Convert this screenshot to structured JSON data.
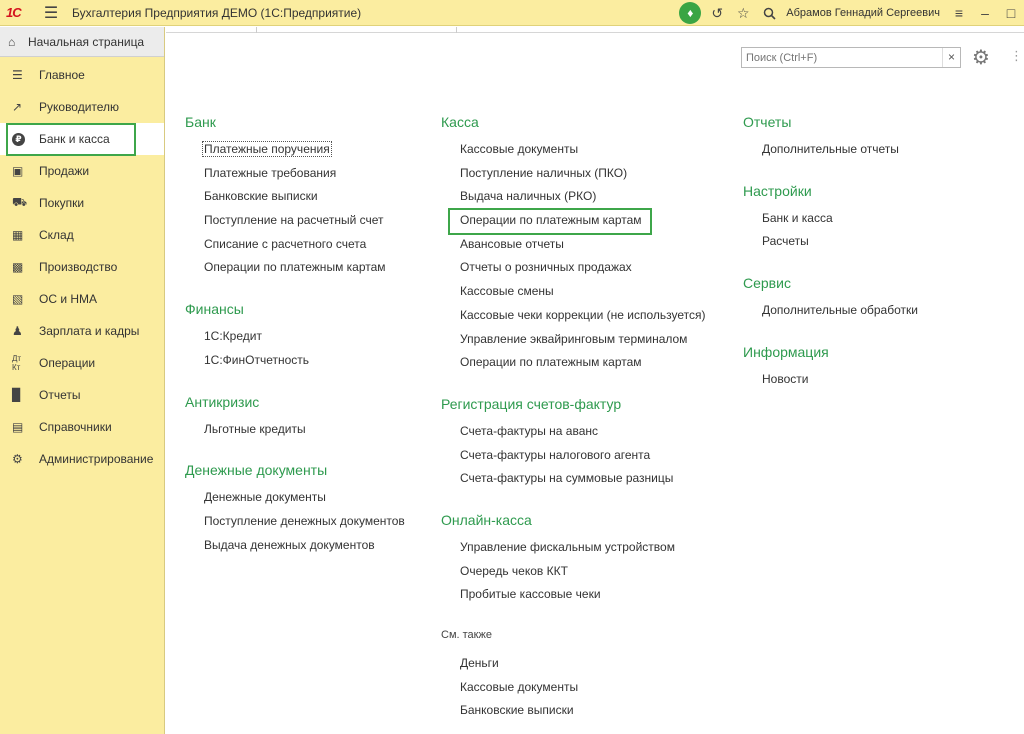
{
  "title_bar": {
    "logo": "1С",
    "title": "Бухгалтерия Предприятия ДЕМО  (1С:Предприятие)",
    "user": "Абрамов Геннадий Сергеевич"
  },
  "sidebar": {
    "home": "Начальная страница",
    "items": [
      {
        "label": "Главное",
        "icon": "menu-lines-icon"
      },
      {
        "label": "Руководителю",
        "icon": "trend-chart-icon"
      },
      {
        "label": "Банк и касса",
        "icon": "ruble-circle-icon"
      },
      {
        "label": "Продажи",
        "icon": "shopping-bag-icon"
      },
      {
        "label": "Покупки",
        "icon": "shopping-cart-icon"
      },
      {
        "label": "Склад",
        "icon": "grid-icon"
      },
      {
        "label": "Производство",
        "icon": "factory-icon"
      },
      {
        "label": "ОС и НМА",
        "icon": "truck-icon"
      },
      {
        "label": "Зарплата и кадры",
        "icon": "person-icon"
      },
      {
        "label": "Операции",
        "icon": "debit-credit-icon"
      },
      {
        "label": "Отчеты",
        "icon": "bar-chart-icon"
      },
      {
        "label": "Справочники",
        "icon": "books-icon"
      },
      {
        "label": "Администрирование",
        "icon": "gear-icon"
      }
    ],
    "active_index": 2
  },
  "search": {
    "placeholder": "Поиск (Ctrl+F)",
    "clear": "×"
  },
  "col1": {
    "bank": {
      "title": "Банк",
      "links": [
        "Платежные поручения",
        "Платежные требования",
        "Банковские выписки",
        "Поступление на расчетный счет",
        "Списание с расчетного счета",
        "Операции по платежным картам"
      ]
    },
    "finance": {
      "title": "Финансы",
      "links": [
        "1С:Кредит",
        "1С:ФинОтчетность"
      ]
    },
    "anticrisis": {
      "title": "Антикризис",
      "links": [
        "Льготные кредиты"
      ]
    },
    "money_docs": {
      "title": "Денежные документы",
      "links": [
        "Денежные документы",
        "Поступление денежных документов",
        "Выдача денежных документов"
      ]
    }
  },
  "col2": {
    "kassa": {
      "title": "Касса",
      "links": [
        "Кассовые документы",
        "Поступление наличных (ПКО)",
        "Выдача наличных (РКО)",
        "Операции по платежным картам",
        "Авансовые отчеты",
        "Отчеты о розничных продажах",
        "Кассовые смены",
        "Кассовые чеки коррекции (не используется)",
        "Управление эквайринговым терминалом",
        "Операции по платежным картам"
      ]
    },
    "invoices": {
      "title": "Регистрация счетов-фактур",
      "links": [
        "Счета-фактуры на аванс",
        "Счета-фактуры налогового агента",
        "Счета-фактуры на суммовые разницы"
      ]
    },
    "online": {
      "title": "Онлайн-касса",
      "links": [
        "Управление фискальным устройством",
        "Очередь чеков ККТ",
        "Пробитые кассовые чеки"
      ]
    },
    "see_also": {
      "title": "См. также",
      "links": [
        "Деньги",
        "Кассовые документы",
        "Банковские выписки"
      ]
    }
  },
  "col3": {
    "reports": {
      "title": "Отчеты",
      "links": [
        "Дополнительные отчеты"
      ]
    },
    "settings": {
      "title": "Настройки",
      "links": [
        "Банк и касса",
        "Расчеты"
      ]
    },
    "service": {
      "title": "Сервис",
      "links": [
        "Дополнительные обработки"
      ]
    },
    "info": {
      "title": "Информация",
      "links": [
        "Новости"
      ]
    }
  },
  "colors": {
    "accent_green": "#2e9a4e",
    "highlight_green": "#3ea64a",
    "panel_yellow": "#fbeda0"
  }
}
